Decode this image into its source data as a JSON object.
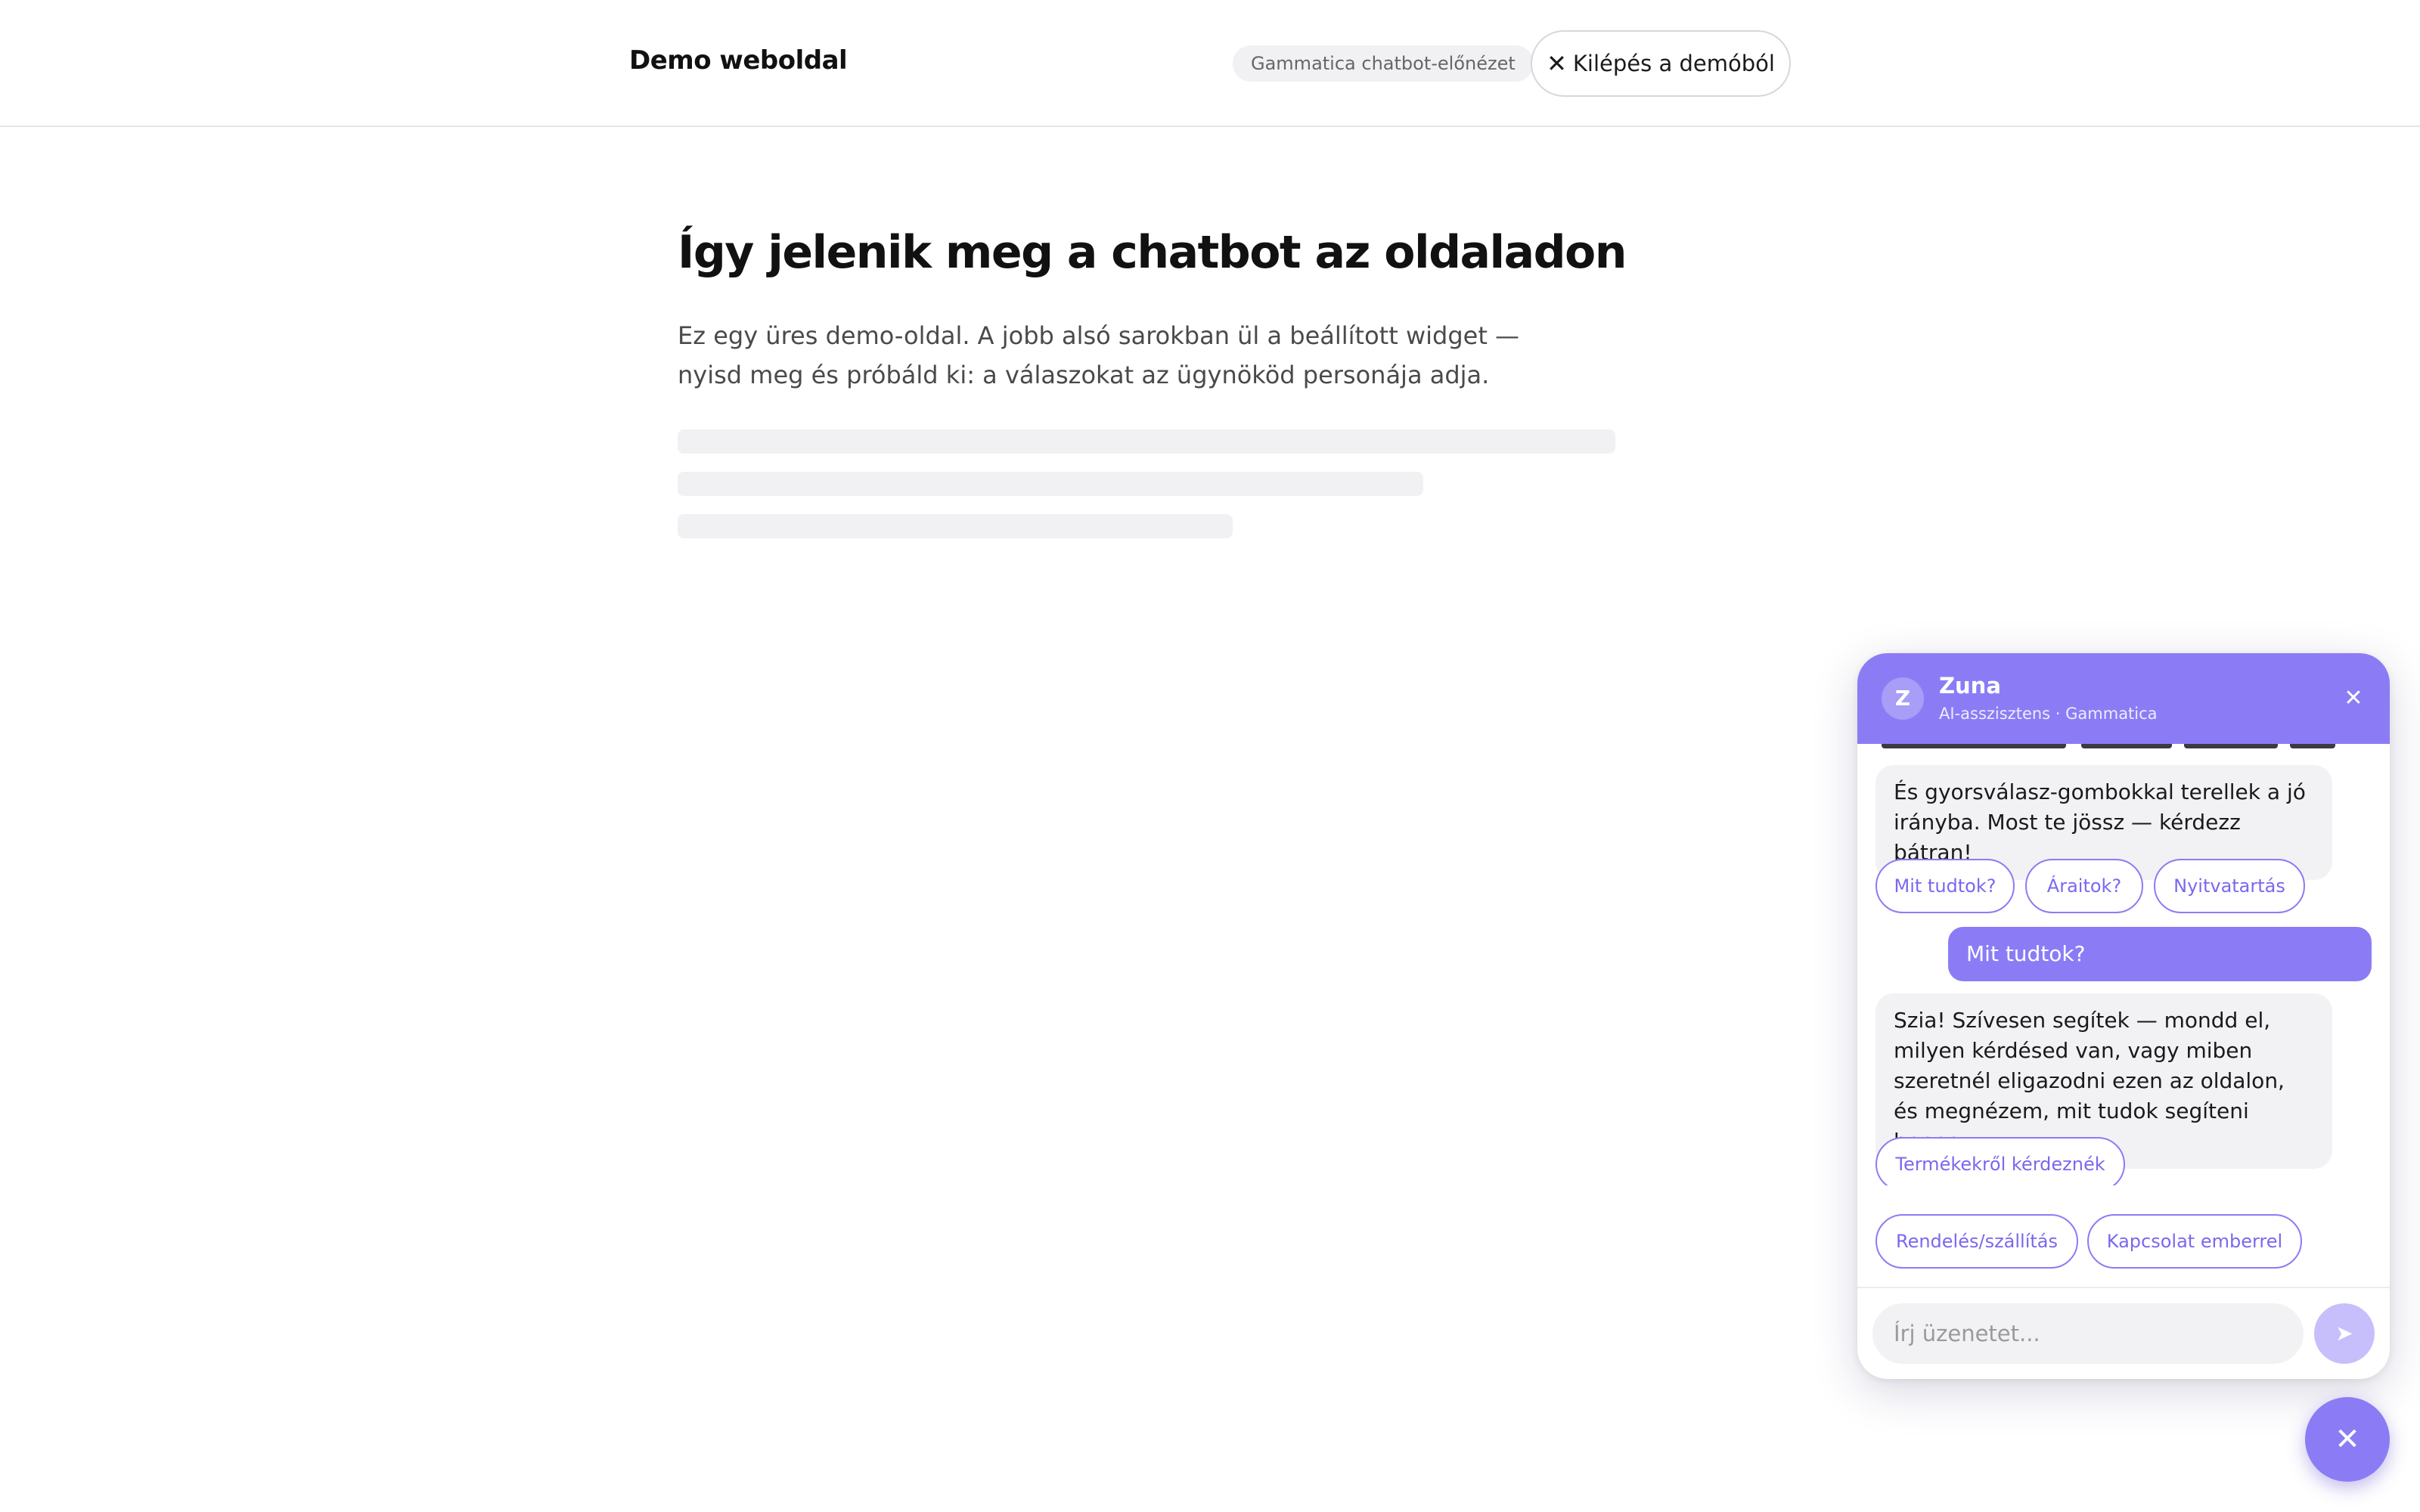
{
  "header": {
    "brand": "Demo weboldal",
    "preview_badge": "Gammatica chatbot-előnézet",
    "exit_label": "Kilépés a demóból"
  },
  "main": {
    "headline": "Így jelenik meg a chatbot az oldaladon",
    "lead": "Ez egy üres demo-oldal. A jobb alsó sarokban ül a beállított widget — nyisd meg és próbáld ki: a válaszokat az ügynököd personája adja."
  },
  "chat": {
    "accent_color": "#8b7cf5",
    "avatar_initial": "Z",
    "agent_name": "Zuna",
    "agent_subtitle": "AI-asszisztens · Gammatica",
    "messages": {
      "bot_intro": "És gyorsválasz-gombokkal terellek a jó irányba. Most te jössz — kérdezz bátran!",
      "quick_replies_1": [
        "Mit tudtok?",
        "Áraitok?",
        "Nyitvatartás"
      ],
      "user_message": "Mit tudtok?",
      "bot_reply": "Szia! Szívesen segítek — mondd el, milyen kérdésed van, vagy miben szeretnél eligazodni ezen az oldalon, és megnézem, mit tudok segíteni benne.",
      "quick_replies_2": [
        "Termékekről kérdeznék",
        "Rendelés/szállítás",
        "Kapcsolat emberrel"
      ]
    },
    "input_placeholder": "Írj üzenetet...",
    "send_icon": "send-icon",
    "close_icon": "close-icon"
  }
}
